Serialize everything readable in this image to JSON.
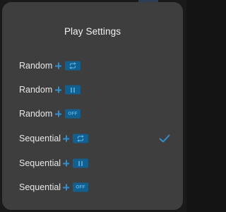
{
  "title": "Play Settings",
  "plus_symbol": "+",
  "colors": {
    "sheet_background": "#3e3e3e",
    "accent": "#2f8fd1",
    "badge_background": "#11608f",
    "badge_foreground": "#5cb3ea",
    "text": "#e8e8e8"
  },
  "options": [
    {
      "label": "Random",
      "badge_icon": "repeat-icon",
      "badge_text": "",
      "selected": false
    },
    {
      "label": "Random",
      "badge_icon": "pause-icon",
      "badge_text": "",
      "selected": false
    },
    {
      "label": "Random",
      "badge_icon": "",
      "badge_text": "OFF",
      "selected": false
    },
    {
      "label": "Sequential",
      "badge_icon": "repeat-icon",
      "badge_text": "",
      "selected": true
    },
    {
      "label": "Sequential",
      "badge_icon": "pause-icon",
      "badge_text": "",
      "selected": false
    },
    {
      "label": "Sequential",
      "badge_icon": "",
      "badge_text": "OFF",
      "selected": false
    }
  ]
}
